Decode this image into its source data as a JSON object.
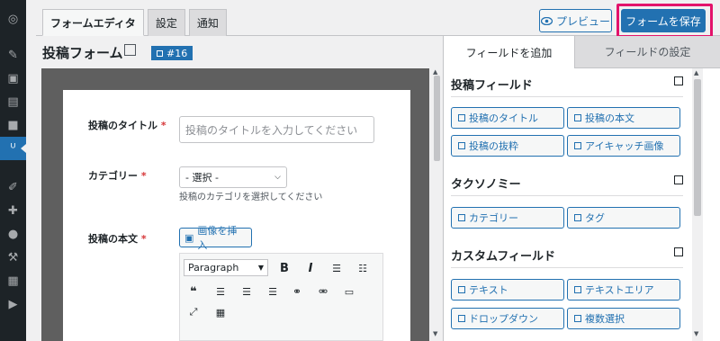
{
  "admin_sidebar": {
    "items": [
      {
        "icon": "dashboard-icon",
        "glyph": "◎"
      },
      {
        "icon": "pin-icon",
        "glyph": "✎"
      },
      {
        "icon": "media-icon",
        "glyph": "▣"
      },
      {
        "icon": "pages-icon",
        "glyph": "▤"
      },
      {
        "icon": "comments-icon",
        "glyph": "■"
      },
      {
        "icon": "forms-plugin-icon",
        "glyph": "ᵁ",
        "active": true
      },
      {
        "icon": "appearance-icon",
        "glyph": "✐"
      },
      {
        "icon": "plugins-icon",
        "glyph": "✚"
      },
      {
        "icon": "users-icon",
        "glyph": "●"
      },
      {
        "icon": "tools-icon",
        "glyph": "⚒"
      },
      {
        "icon": "settings-icon",
        "glyph": "▦"
      },
      {
        "icon": "collapse-icon",
        "glyph": "▶"
      }
    ]
  },
  "tabs": [
    {
      "label": "フォームエディタ",
      "active": true
    },
    {
      "label": "設定",
      "active": false
    },
    {
      "label": "通知",
      "active": false
    }
  ],
  "toolbar": {
    "preview_label": "プレビュー",
    "save_label": "フォームを保存"
  },
  "form": {
    "title": "投稿フォーム",
    "id_badge": "#16"
  },
  "preview": {
    "title_label": "投稿のタイトル",
    "title_placeholder": "投稿のタイトルを入力してください",
    "category_label": "カテゴリー",
    "category_value": "- 選択 -",
    "category_help": "投稿のカテゴリを選択してください",
    "content_label": "投稿の本文",
    "insert_image_label": "画像を挿入",
    "format_value": "Paragraph",
    "required_mark": "*"
  },
  "right_panel": {
    "tab_add": "フィールドを追加",
    "tab_settings": "フィールドの設定",
    "sections": [
      {
        "heading": "投稿フィールド",
        "buttons": [
          "投稿のタイトル",
          "投稿の本文",
          "投稿の抜粋",
          "アイキャッチ画像"
        ]
      },
      {
        "heading": "タクソノミー",
        "buttons": [
          "カテゴリー",
          "タグ"
        ]
      },
      {
        "heading": "カスタムフィールド",
        "buttons": [
          "テキスト",
          "テキストエリア",
          "ドロップダウン",
          "複数選択"
        ]
      }
    ]
  },
  "colors": {
    "accent": "#2271b1",
    "highlight_outline": "#e3136b",
    "admin_sidebar": "#1d2327",
    "required": "#d63638"
  }
}
